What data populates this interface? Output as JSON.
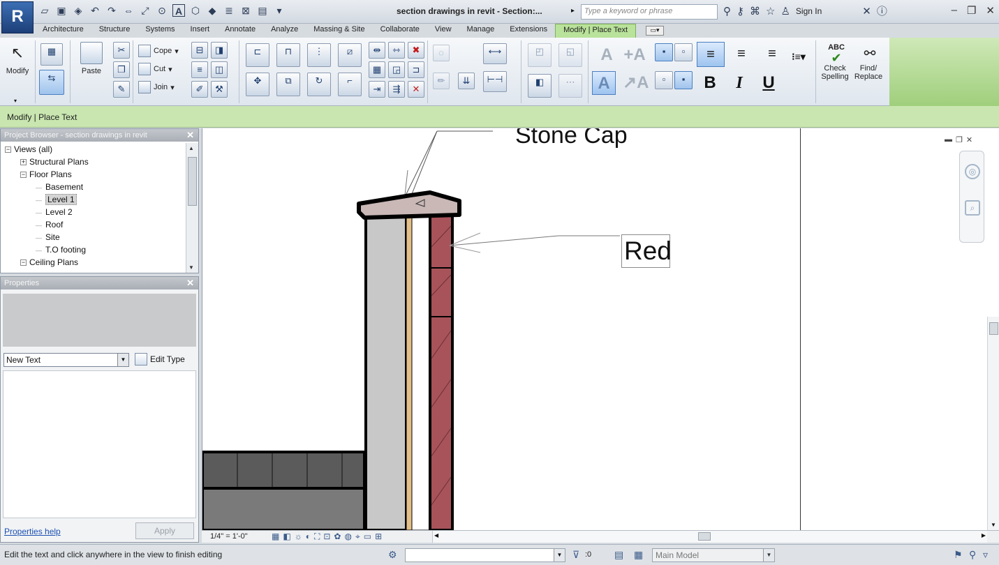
{
  "app": {
    "logo": "R"
  },
  "titlebar": {
    "title": "section drawings in revit - Section:...",
    "search_placeholder": "Type a keyword or phrase",
    "sign_in": "Sign In"
  },
  "ribbon": {
    "tabs": [
      "Architecture",
      "Structure",
      "Systems",
      "Insert",
      "Annotate",
      "Analyze",
      "Massing & Site",
      "Collaborate",
      "View",
      "Manage",
      "Extensions",
      "Modify | Place Text"
    ],
    "active_tab": "Modify | Place Text",
    "modify_label": "Modify",
    "paste_label": "Paste",
    "cope_label": "Cope",
    "cut_label": "Cut",
    "join_label": "Join",
    "check_spelling_label": "Check Spelling",
    "find_replace_label": "Find/ Replace",
    "abc_text": "ABC",
    "bold_label": "B",
    "italic_label": "I",
    "underline_label": "U",
    "text_icon_label": "A"
  },
  "options_bar": {
    "label": "Modify | Place Text"
  },
  "project_browser": {
    "title": "Project Browser - section drawings in revit",
    "items": [
      {
        "label": "Views (all)",
        "indent": 0,
        "expander": "−",
        "selected": false
      },
      {
        "label": "Structural Plans",
        "indent": 1,
        "expander": "+",
        "selected": false
      },
      {
        "label": "Floor Plans",
        "indent": 1,
        "expander": "−",
        "selected": false
      },
      {
        "label": "Basement",
        "indent": 2,
        "expander": "",
        "selected": false
      },
      {
        "label": "Level 1",
        "indent": 2,
        "expander": "",
        "selected": true
      },
      {
        "label": "Level 2",
        "indent": 2,
        "expander": "",
        "selected": false
      },
      {
        "label": "Roof",
        "indent": 2,
        "expander": "",
        "selected": false
      },
      {
        "label": "Site",
        "indent": 2,
        "expander": "",
        "selected": false
      },
      {
        "label": "T.O footing",
        "indent": 2,
        "expander": "",
        "selected": false
      },
      {
        "label": "Ceiling Plans",
        "indent": 1,
        "expander": "−",
        "selected": false
      }
    ]
  },
  "properties": {
    "title": "Properties",
    "type_selector": "New Text",
    "edit_type_label": "Edit Type",
    "help_link": "Properties help",
    "apply_label": "Apply"
  },
  "canvas": {
    "annotation_label": "Stone Cap",
    "editing_text": "Red"
  },
  "view_control": {
    "scale": "1/4\" = 1'-0\""
  },
  "status_bar": {
    "message": "Edit the text and click anywhere in the view to finish editing",
    "selection_count": ":0",
    "model": "Main Model"
  },
  "colors": {
    "ribbon_active_tab": "#b9e29a",
    "options_bar": "#c9e6b0",
    "brick": "#a8535a",
    "stone_cap": "#c9b8b6",
    "concrete": "#c8c8c8",
    "wall_block": "#5b5b5b"
  }
}
